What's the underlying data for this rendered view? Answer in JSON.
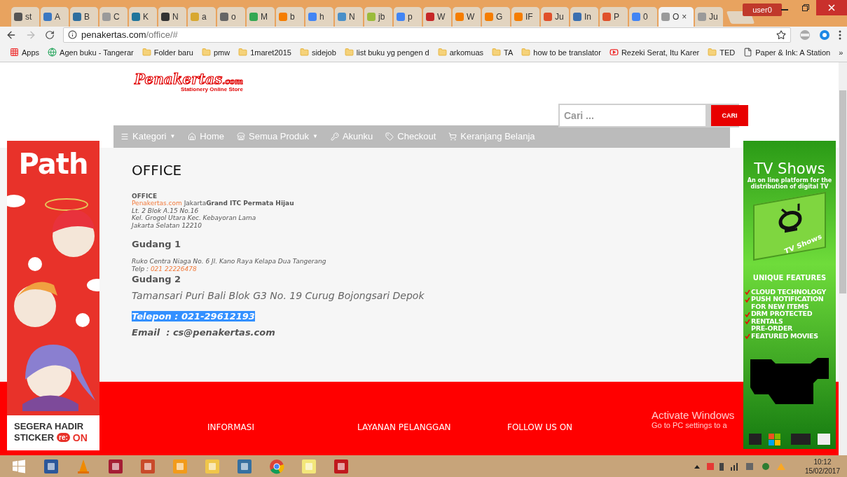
{
  "browser": {
    "tabs": [
      {
        "title": "st",
        "color": "#555555",
        "selected": false
      },
      {
        "title": "A",
        "color": "#3b78c2",
        "selected": false
      },
      {
        "title": "B",
        "color": "#2f6f9f",
        "selected": false
      },
      {
        "title": "C",
        "color": "#9a9a9a",
        "selected": false
      },
      {
        "title": "K",
        "color": "#21759b",
        "selected": false
      },
      {
        "title": "N",
        "color": "#333333",
        "selected": false
      },
      {
        "title": "a",
        "color": "#d8a830",
        "selected": false
      },
      {
        "title": "o",
        "color": "#666666",
        "selected": false
      },
      {
        "title": "M",
        "color": "#34a853",
        "selected": false
      },
      {
        "title": "b",
        "color": "#f57d00",
        "selected": false
      },
      {
        "title": "h",
        "color": "#4285f4",
        "selected": false
      },
      {
        "title": "N",
        "color": "#4a90c8",
        "selected": false
      },
      {
        "title": "jb",
        "color": "#9bbb3b",
        "selected": false
      },
      {
        "title": "p",
        "color": "#4285f4",
        "selected": false
      },
      {
        "title": "W",
        "color": "#c62828",
        "selected": false
      },
      {
        "title": "W",
        "color": "#f57d00",
        "selected": false
      },
      {
        "title": "G",
        "color": "#f57d00",
        "selected": false
      },
      {
        "title": "IF",
        "color": "#f57d00",
        "selected": false
      },
      {
        "title": "Ju",
        "color": "#e0502a",
        "selected": false
      },
      {
        "title": "In",
        "color": "#3a6fb0",
        "selected": false
      },
      {
        "title": "P",
        "color": "#e0502a",
        "selected": false
      },
      {
        "title": "0",
        "color": "#4285f4",
        "selected": false
      },
      {
        "title": "O",
        "color": "#9a9a9a",
        "selected": true,
        "close": "×"
      },
      {
        "title": "Ju",
        "color": "#9a9a9a",
        "selected": false
      }
    ],
    "user": "user0",
    "address": {
      "host": "penakertas.com",
      "path": "/office/#"
    },
    "bookmarks": [
      {
        "label": "Apps",
        "kind": "apps"
      },
      {
        "label": "Agen buku - Tangerar",
        "kind": "site"
      },
      {
        "label": "Folder baru",
        "kind": "folder"
      },
      {
        "label": "pmw",
        "kind": "folder"
      },
      {
        "label": "1maret2015",
        "kind": "folder"
      },
      {
        "label": "sidejob",
        "kind": "folder"
      },
      {
        "label": "list buku yg pengen d",
        "kind": "folder"
      },
      {
        "label": "arkomuas",
        "kind": "folder"
      },
      {
        "label": "TA",
        "kind": "folder"
      },
      {
        "label": "how to be translator",
        "kind": "folder"
      },
      {
        "label": "Rezeki Serat, Itu Karer",
        "kind": "video"
      },
      {
        "label": "TED",
        "kind": "folder"
      },
      {
        "label": "Paper & Ink: A Station",
        "kind": "page"
      }
    ],
    "bookmarks_more": "»"
  },
  "header": {
    "logo": {
      "name": "Penakertas",
      "suffix": ".com",
      "tagline": "Stationery Online Store"
    },
    "search": {
      "placeholder": "Cari ...",
      "button": "CARI"
    }
  },
  "nav": [
    {
      "label": "Kategori",
      "kind": "menu",
      "caret": "▼"
    },
    {
      "label": "Home",
      "kind": "home"
    },
    {
      "label": "Semua Produk",
      "kind": "store",
      "caret": "▼"
    },
    {
      "label": "Akunku",
      "kind": "key"
    },
    {
      "label": "Checkout",
      "kind": "tag"
    },
    {
      "label": "Keranjang Belanja",
      "kind": "cart"
    }
  ],
  "content": {
    "title": "OFFICE",
    "office": {
      "heading": "OFFICE",
      "brand": "Penakertas.com",
      "location": " Jakarta**Grand ITC Permata Hijau**",
      "lines": [
        "Lt. 2 Blok A.15 No.16",
        "Kel. Grogol Utara Kec. Kebayoran Lama",
        "Jakarta Selatan 12210"
      ]
    },
    "gudang_1": {
      "heading": "Gudang 1",
      "address": "Ruko Centra Niaga No. 6 Jl. Kano Raya Kelapa Dua Tangerang",
      "phone_label": "Telp : ",
      "phone": "021 22226478"
    },
    "gudang_2": {
      "heading": "Gudang 2",
      "address": "Tamansari Puri Bali Blok G3 No. 19 Curug Bojongsari Depok",
      "phone": {
        "text": "Telepon : 021-29612193",
        "selected": true
      },
      "email": "Email  : cs@penakertas.com"
    }
  },
  "footer": {
    "columns": [
      "INFORMASI",
      "LAYANAN PELANGGAN",
      "FOLLOW US ON"
    ]
  },
  "ads": {
    "left": {
      "brand": "Path",
      "lines": [
        "SEGERA HADIR",
        "STICKER"
      ],
      "badge": "re:",
      "badge_suffix": "ON"
    },
    "right": {
      "title": "TV Shows",
      "subtitle": "An on line platform for the distribution of digital TV",
      "box_label": "TV Shows",
      "features_title": "UNIQUE FEATURES",
      "features": [
        {
          "text": "CLOUD TECHNOLOGY",
          "checked": true
        },
        {
          "text": "PUSH NOTIFICATION",
          "checked": true
        },
        {
          "text": "FOR NEW ITEMS",
          "checked": false
        },
        {
          "text": "DRM PROTECTED",
          "checked": true
        },
        {
          "text": "RENTALS",
          "checked": true
        },
        {
          "text": "PRE-ORDER",
          "checked": false
        },
        {
          "text": "FEATURED MOVIES",
          "checked": true
        }
      ]
    }
  },
  "os_notice": {
    "title": "Activate Windows",
    "text": "Go to PC settings to a"
  },
  "taskbar": {
    "apps": [
      {
        "kind": "start"
      },
      {
        "kind": "word"
      },
      {
        "kind": "vlc"
      },
      {
        "kind": "mendeley"
      },
      {
        "kind": "book"
      },
      {
        "kind": "media"
      },
      {
        "kind": "explorer"
      },
      {
        "kind": "python"
      },
      {
        "kind": "chrome"
      },
      {
        "kind": "notes"
      },
      {
        "kind": "pdf"
      }
    ],
    "time": "10:12",
    "date": "15/02/2017"
  }
}
